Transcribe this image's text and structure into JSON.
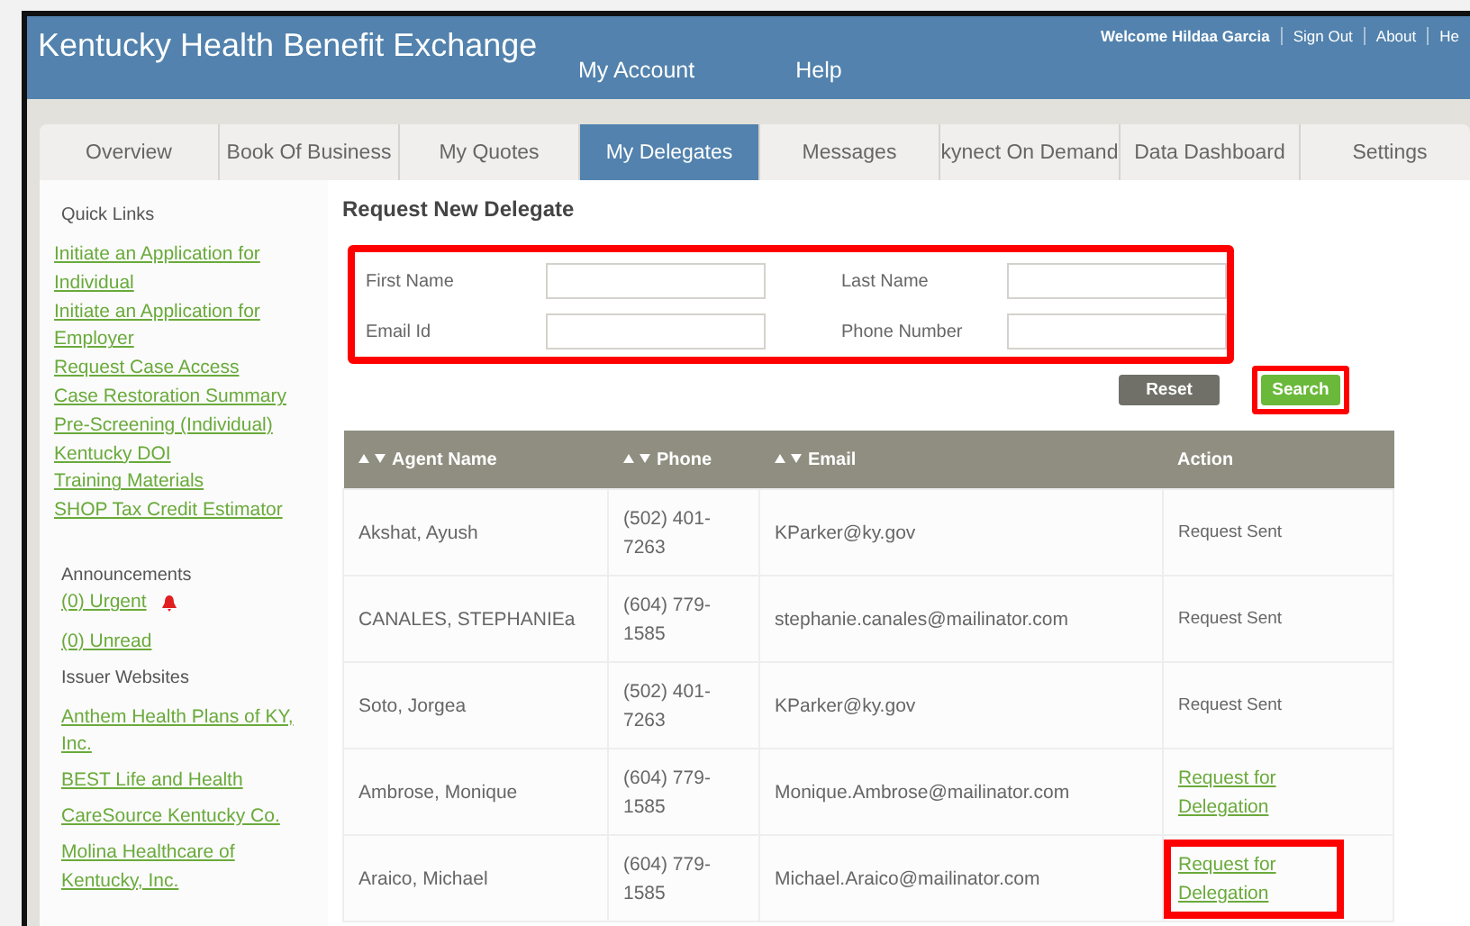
{
  "header": {
    "title": "Kentucky Health Benefit Exchange",
    "nav": [
      "My Account",
      "Help"
    ],
    "user_links": [
      "Welcome Hildaa Garcia",
      "Sign Out",
      "About",
      "He"
    ]
  },
  "tabs": [
    {
      "label": "Overview",
      "selected": false
    },
    {
      "label": "Book Of Business",
      "selected": false
    },
    {
      "label": "My Quotes",
      "selected": false
    },
    {
      "label": "My Delegates",
      "selected": true
    },
    {
      "label": "Messages",
      "selected": false
    },
    {
      "label": "kynect On Demand",
      "selected": false
    },
    {
      "label": "Data Dashboard",
      "selected": false
    },
    {
      "label": "Settings",
      "selected": false
    }
  ],
  "sidebar": {
    "quick_links_title": "Quick Links",
    "quick_links": [
      "Initiate an Application for Individual",
      "Initiate an Application for Employer",
      "Request Case Access",
      "Case Restoration Summary",
      "Pre-Screening (Individual)",
      "Kentucky DOI",
      "Training Materials",
      "SHOP Tax Credit Estimator"
    ],
    "announcements_title": "Announcements",
    "announcements": [
      {
        "label": "(0) Urgent",
        "alert": true
      },
      {
        "label": "(0) Unread",
        "alert": false
      }
    ],
    "issuer_title": "Issuer Websites",
    "issuers": [
      "Anthem Health Plans of KY, Inc.",
      "BEST Life and Health",
      "CareSource Kentucky Co.",
      "Molina Healthcare of Kentucky, Inc."
    ]
  },
  "form": {
    "title": "Request New Delegate",
    "highlighted": true,
    "fields": [
      {
        "label": "First Name"
      },
      {
        "label": "Last Name"
      },
      {
        "label": "Email Id"
      },
      {
        "label": "Phone Number"
      }
    ],
    "buttons": [
      {
        "label": "Reset",
        "kind": "secondary",
        "highlighted": false
      },
      {
        "label": "Search",
        "kind": "primary",
        "highlighted": true
      }
    ]
  },
  "table": {
    "columns": [
      "Agent Name",
      "Phone",
      "Email",
      "Action"
    ],
    "rows": [
      {
        "name": "Akshat, Ayush",
        "phone": "(502) 401-7263",
        "email": "KParker@ky.gov",
        "action": {
          "kind": "status",
          "label": "Request Sent"
        }
      },
      {
        "name": "CANALES, STEPHANIEa",
        "phone": "(604) 779-1585",
        "email": "stephanie.canales@mailinator.com",
        "action": {
          "kind": "status",
          "label": "Request Sent"
        }
      },
      {
        "name": "Soto, Jorgea",
        "phone": "(502) 401-7263",
        "email": "KParker@ky.gov",
        "action": {
          "kind": "status",
          "label": "Request Sent"
        }
      },
      {
        "name": "Ambrose, Monique",
        "phone": "(604) 779-1585",
        "email": "Monique.Ambrose@mailinator.com",
        "action": {
          "kind": "link",
          "label": "Request for Delegation",
          "highlighted": false
        }
      },
      {
        "name": "Araico, Michael",
        "phone": "(604) 779-1585",
        "email": "Michael.Araico@mailinator.com",
        "action": {
          "kind": "link",
          "label": "Request for Delegation",
          "highlighted": true
        }
      }
    ]
  }
}
